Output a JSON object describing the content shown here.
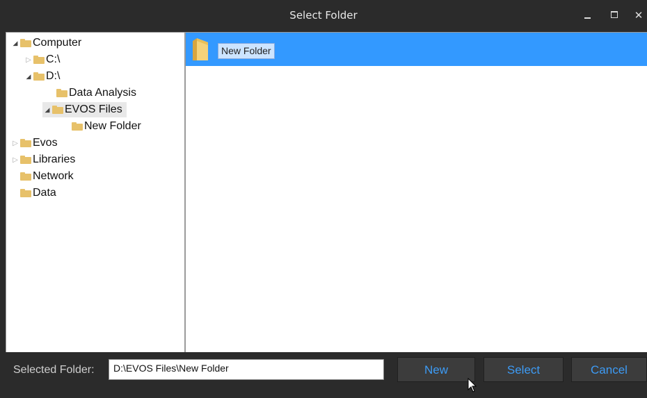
{
  "window": {
    "title": "Select Folder"
  },
  "tree": [
    {
      "label": "Computer",
      "expander": "open"
    },
    {
      "label": "C:\\",
      "expander": "closed"
    },
    {
      "label": "D:\\",
      "expander": "open"
    },
    {
      "label": "Data Analysis",
      "expander": "none"
    },
    {
      "label": "EVOS Files",
      "expander": "open",
      "selected": true
    },
    {
      "label": "New Folder",
      "expander": "none"
    },
    {
      "label": "Evos",
      "expander": "closed"
    },
    {
      "label": "Libraries",
      "expander": "closed"
    },
    {
      "label": "Network",
      "expander": "none"
    },
    {
      "label": "Data",
      "expander": "none"
    }
  ],
  "list": {
    "items": [
      {
        "label": "New Folder",
        "selected": true
      }
    ]
  },
  "bottom": {
    "selected_label": "Selected Folder:",
    "selected_path": "D:\\EVOS Files\\New Folder",
    "new_label": "New",
    "select_label": "Select",
    "cancel_label": "Cancel"
  },
  "colors": {
    "accent": "#3399ff",
    "button_text": "#3d9bf5",
    "chrome": "#2b2b2b",
    "folder": "#e7c16a"
  },
  "icons": [
    "folder-icon",
    "expand-arrow-icon",
    "collapsed-arrow-icon",
    "minimize-icon",
    "maximize-icon",
    "close-icon",
    "mouse-cursor-icon"
  ]
}
